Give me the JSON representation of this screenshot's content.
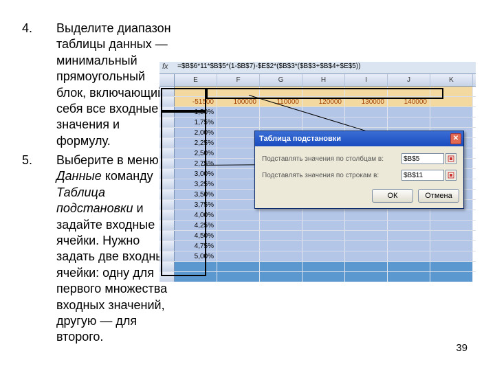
{
  "page_number": "39",
  "items": [
    {
      "num": "4.",
      "html": "Выделите диапазон таблицы данных — минимальный прямоугольный блок, включающий в себя все входные значения и формулу."
    },
    {
      "num": "5.",
      "html": "Выберите в меню <span class='em'>Данные</span> команду <span class='em'>Таблица подстановки</span> и задайте входные ячейки. Нужно задать две входные ячейки: одну для первого множества входных значений, другую — для второго."
    }
  ],
  "formula_bar": {
    "fx": "fx",
    "text": "=$B$6*11*$B$5*(1-$B$7)-$E$2*($B$3*($B$3+$B$4+$E$5))"
  },
  "col_headers": [
    "E",
    "F",
    "G",
    "H",
    "I",
    "J",
    "K"
  ],
  "top_values": [
    "-51500",
    "100000",
    "110000",
    "120000",
    "130000",
    "140000"
  ],
  "side_pcts": [
    "1,50%",
    "1,75%",
    "2,00%",
    "2,25%",
    "2,50%",
    "2,75%",
    "3,00%",
    "3,25%",
    "3,50%",
    "3,75%",
    "4,00%",
    "4,25%",
    "4,50%",
    "4,75%",
    "5,00%"
  ],
  "dialog": {
    "title": "Таблица подстановки",
    "row1_label": "Подставлять значения по столбцам в:",
    "row1_value": "$B$5",
    "row2_label": "Подставлять значения по строкам в:",
    "row2_value": "$B$11",
    "ok": "ОК",
    "cancel": "Отмена"
  }
}
